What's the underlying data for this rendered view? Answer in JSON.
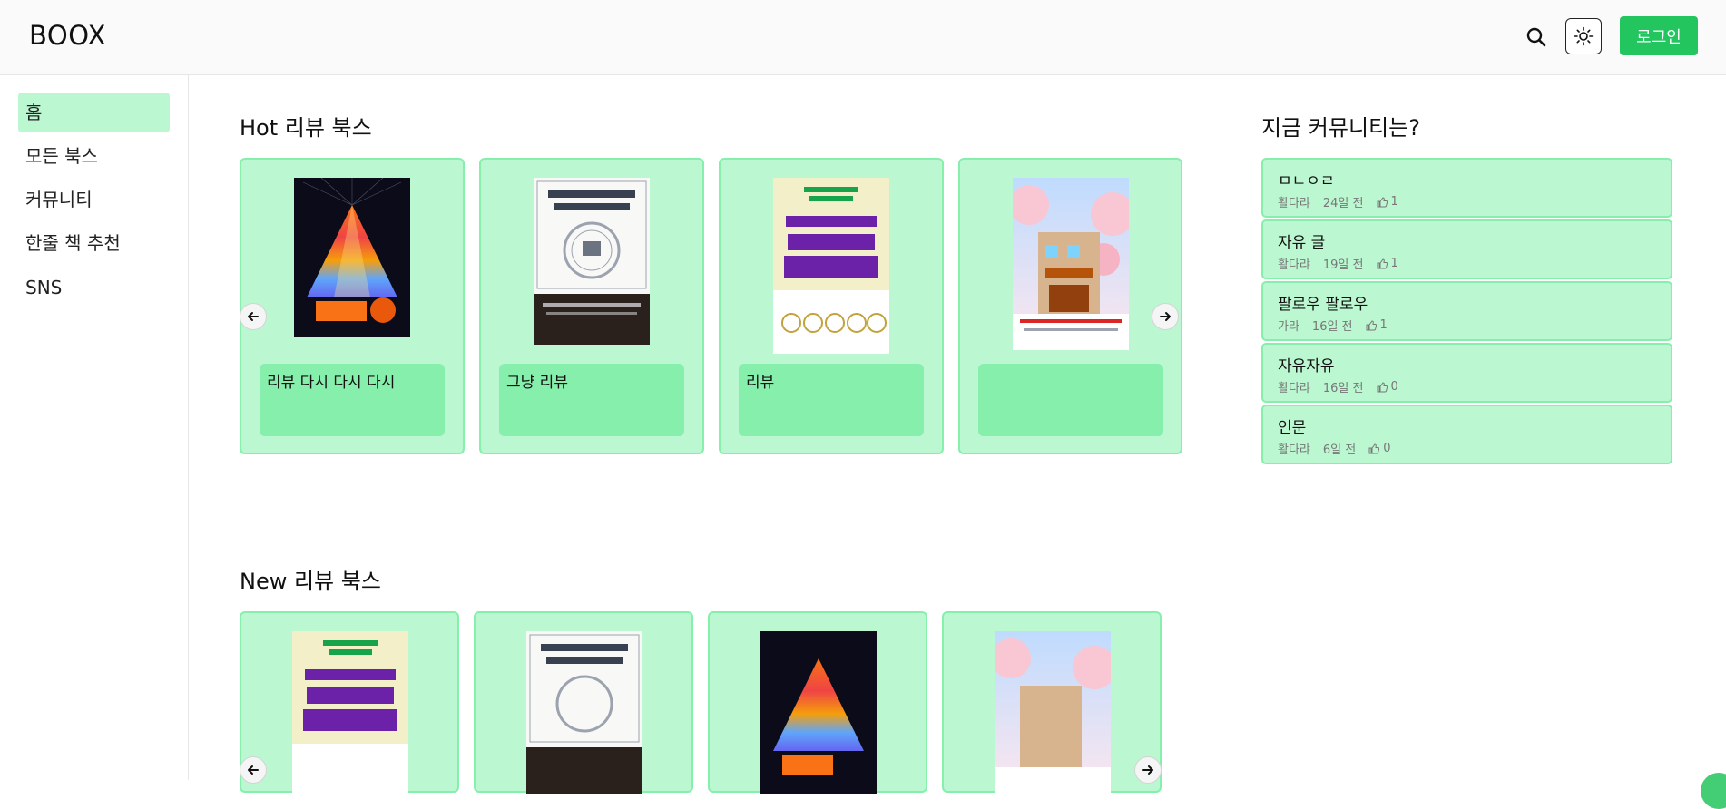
{
  "header": {
    "logo": "BOOX",
    "login_label": "로그인"
  },
  "sidebar": {
    "items": [
      {
        "label": "홈",
        "active": true
      },
      {
        "label": "모든 북스"
      },
      {
        "label": "커뮤니티"
      },
      {
        "label": "한줄 책 추천"
      },
      {
        "label": "SNS"
      }
    ]
  },
  "hot": {
    "title": "Hot 리뷰 북스",
    "cards": [
      {
        "caption": "리뷰 다시 다시 다시",
        "cover": "rainbow-pyramid"
      },
      {
        "caption": "그냥 리뷰",
        "cover": "knowledge-book"
      },
      {
        "caption": "리뷰",
        "cover": "world-history"
      },
      {
        "caption": "",
        "cover": "cherry-street"
      }
    ]
  },
  "new": {
    "title": "New 리뷰 북스",
    "cards": [
      {
        "cover": "world-history"
      },
      {
        "cover": "knowledge-book"
      },
      {
        "cover": "rainbow-pyramid"
      },
      {
        "cover": "cherry-street"
      }
    ]
  },
  "community": {
    "title": "지금 커뮤니티는?",
    "posts": [
      {
        "title": "ㅁㄴㅇㄹ",
        "author": "활다랴",
        "time": "24일 전",
        "likes": "1"
      },
      {
        "title": "자유 글",
        "author": "활다랴",
        "time": "19일 전",
        "likes": "1"
      },
      {
        "title": "팔로우 팔로우",
        "author": "가라",
        "time": "16일 전",
        "likes": "1"
      },
      {
        "title": "자유자유",
        "author": "활다랴",
        "time": "16일 전",
        "likes": "0"
      },
      {
        "title": "인문",
        "author": "활다랴",
        "time": "6일 전",
        "likes": "0"
      }
    ]
  },
  "colors": {
    "accent": "#22c55e",
    "card_bg": "#bbf7d0",
    "card_border": "#86efac"
  }
}
